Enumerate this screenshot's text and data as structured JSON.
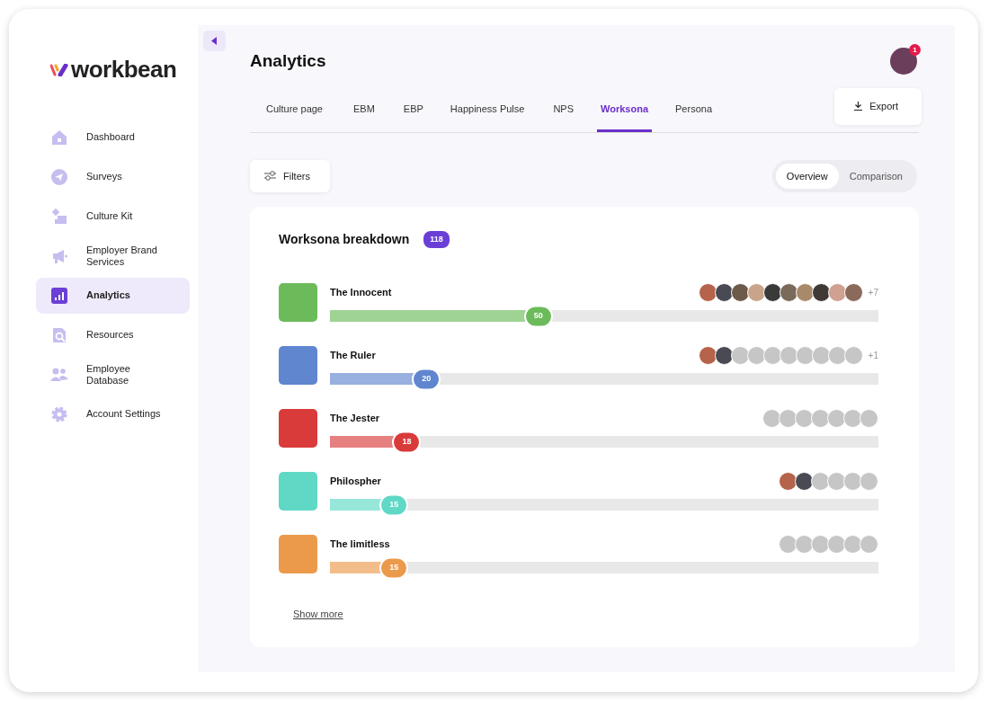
{
  "logo": {
    "text": "workbean"
  },
  "sidebar": {
    "items": [
      {
        "label": "Dashboard",
        "selected": false
      },
      {
        "label": "Surveys",
        "selected": false
      },
      {
        "label": "Culture Kit",
        "selected": false
      },
      {
        "label": "Employer Brand Services",
        "selected": false
      },
      {
        "label": "Analytics",
        "selected": true
      },
      {
        "label": "Resources",
        "selected": false
      },
      {
        "label": "Employee Database",
        "selected": false
      },
      {
        "label": "Account Settings",
        "selected": false
      }
    ]
  },
  "header": {
    "title": "Analytics",
    "notification_count": "1"
  },
  "tabs": [
    {
      "label": "Culture page",
      "selected": false
    },
    {
      "label": "EBM",
      "selected": false
    },
    {
      "label": "EBP",
      "selected": false
    },
    {
      "label": "Happiness Pulse",
      "selected": false
    },
    {
      "label": "NPS",
      "selected": false
    },
    {
      "label": "Worksona",
      "selected": true
    },
    {
      "label": "Persona",
      "selected": false
    }
  ],
  "export_button": {
    "label": "Export"
  },
  "filters_button": {
    "label": "Filters"
  },
  "view_toggle": [
    {
      "label": "Overview",
      "selected": true
    },
    {
      "label": "Comparison",
      "selected": false
    }
  ],
  "breakdown": {
    "title": "Worksona breakdown",
    "count": "118",
    "personas": [
      {
        "name": "The Innocent",
        "value": "50",
        "level": 0.38,
        "color": "#6cbb5a",
        "members": [
          {
            "kind": "photo"
          },
          {
            "kind": "photo"
          },
          {
            "kind": "photo"
          },
          {
            "kind": "photo"
          },
          {
            "kind": "photo"
          },
          {
            "kind": "photo"
          },
          {
            "kind": "photo"
          },
          {
            "kind": "photo"
          },
          {
            "kind": "photo"
          },
          {
            "kind": "photo"
          }
        ],
        "more": "+7"
      },
      {
        "name": "The Ruler",
        "value": "20",
        "level": 0.176,
        "color": "#5f86cf",
        "members": [
          {
            "kind": "photo"
          },
          {
            "kind": "photo"
          },
          {
            "kind": "empty"
          },
          {
            "kind": "empty"
          },
          {
            "kind": "empty"
          },
          {
            "kind": "empty"
          },
          {
            "kind": "empty"
          },
          {
            "kind": "empty"
          },
          {
            "kind": "empty"
          },
          {
            "kind": "empty"
          }
        ],
        "more": "+1"
      },
      {
        "name": "The Jester",
        "value": "18",
        "level": 0.14,
        "color": "#d93a3a",
        "members": [
          {
            "kind": "empty"
          },
          {
            "kind": "empty"
          },
          {
            "kind": "empty"
          },
          {
            "kind": "empty"
          },
          {
            "kind": "empty"
          },
          {
            "kind": "empty"
          },
          {
            "kind": "empty"
          }
        ]
      },
      {
        "name": "Philospher",
        "value": "15",
        "level": 0.117,
        "color": "#5fd8c6",
        "members": [
          {
            "kind": "photo"
          },
          {
            "kind": "photo"
          },
          {
            "kind": "empty"
          },
          {
            "kind": "empty"
          },
          {
            "kind": "empty"
          },
          {
            "kind": "empty"
          }
        ]
      },
      {
        "name": "The limitless",
        "value": "15",
        "level": 0.117,
        "color": "#eb9a4c",
        "members": [
          {
            "kind": "empty"
          },
          {
            "kind": "empty"
          },
          {
            "kind": "empty"
          },
          {
            "kind": "empty"
          },
          {
            "kind": "empty"
          },
          {
            "kind": "empty"
          }
        ]
      }
    ],
    "show_more": "Show more"
  }
}
